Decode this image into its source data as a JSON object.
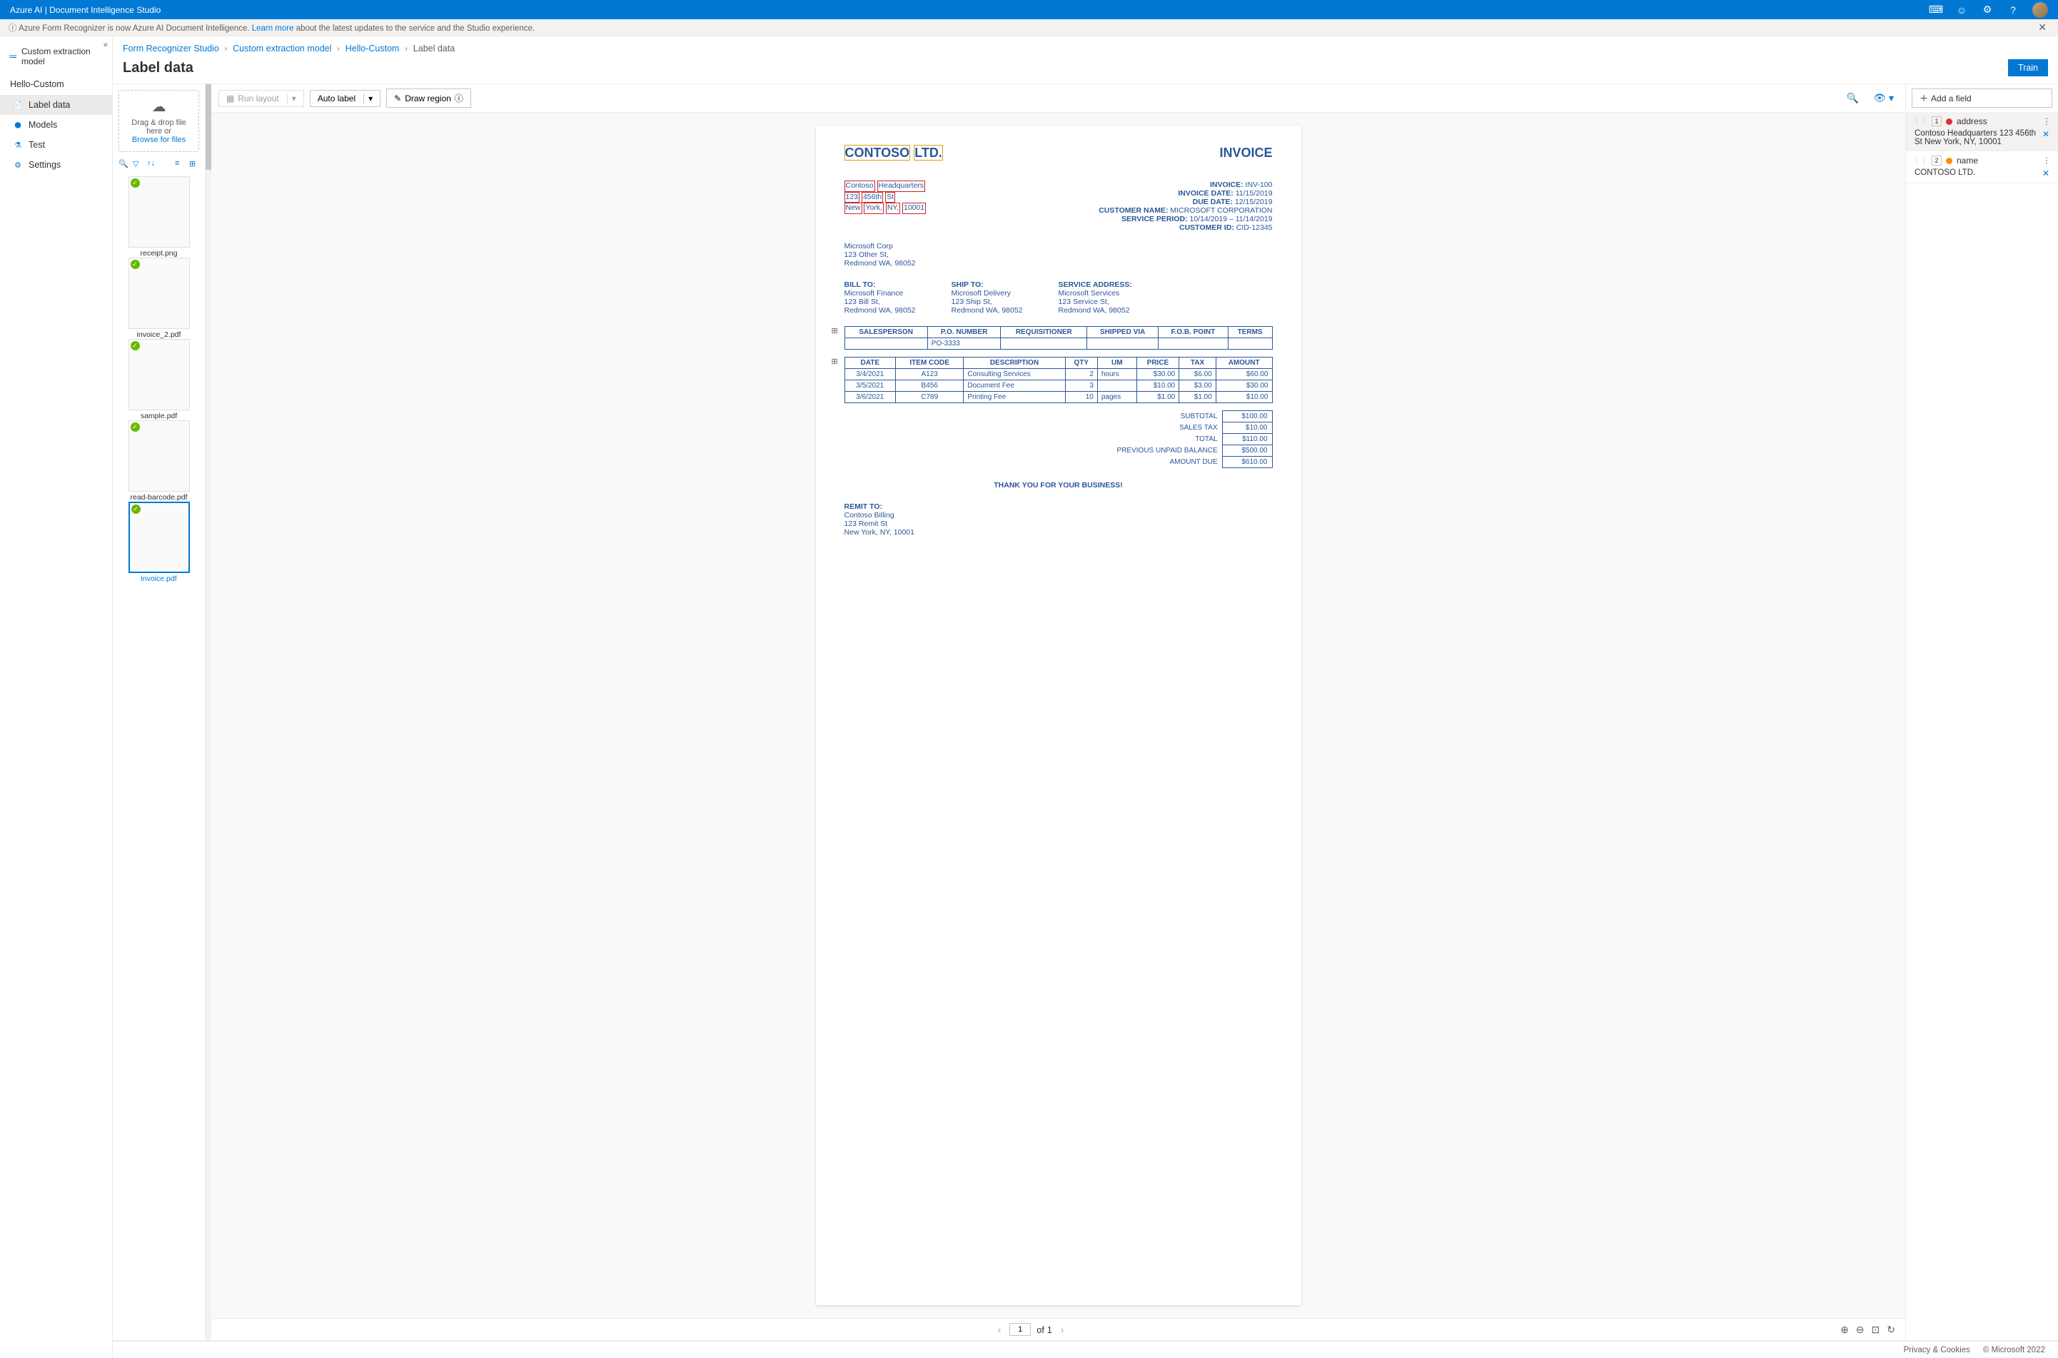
{
  "header": {
    "title": "Azure AI | Document Intelligence Studio"
  },
  "info_bar": {
    "icon": "ⓘ",
    "text_before": "Azure Form Recognizer is now Azure AI Document Intelligence. ",
    "link": "Learn more",
    "text_after": " about the latest updates to the service and the Studio experience."
  },
  "sidebar": {
    "heading": "Custom extraction model",
    "project": "Hello-Custom",
    "items": [
      {
        "icon": "📄",
        "label": "Label data",
        "active": true
      },
      {
        "icon": "⬢",
        "label": "Models",
        "active": false
      },
      {
        "icon": "⚗",
        "label": "Test",
        "active": false
      },
      {
        "icon": "⚙",
        "label": "Settings",
        "active": false
      }
    ]
  },
  "breadcrumb": [
    {
      "label": "Form Recognizer Studio",
      "link": true
    },
    {
      "label": "Custom extraction model",
      "link": true
    },
    {
      "label": "Hello-Custom",
      "link": true
    },
    {
      "label": "Label data",
      "link": false
    }
  ],
  "page_title": "Label data",
  "train_button": "Train",
  "drop_zone": {
    "line1": "Drag & drop file here or",
    "link": "Browse for files"
  },
  "files": [
    {
      "name": "receipt.png",
      "selected": false,
      "analyzed": true
    },
    {
      "name": "invoice_2.pdf",
      "selected": false,
      "analyzed": true
    },
    {
      "name": "sample.pdf",
      "selected": false,
      "analyzed": true
    },
    {
      "name": "read-barcode.pdf",
      "selected": false,
      "analyzed": true
    },
    {
      "name": "invoice.pdf",
      "selected": true,
      "analyzed": true
    }
  ],
  "doc_toolbar": {
    "run_layout": "Run layout",
    "auto_label": "Auto label",
    "draw_region": "Draw region"
  },
  "invoice": {
    "company": "CONTOSO LTD.",
    "company_word_1": "CONTOSO",
    "company_word_2": "LTD.",
    "invoice_word": "INVOICE",
    "address_lines": [
      [
        "Contoso",
        "Headquarters"
      ],
      [
        "123",
        "456th",
        "St"
      ],
      [
        "New",
        "York,",
        "NY,",
        "10001"
      ]
    ],
    "meta": [
      {
        "label": "INVOICE:",
        "value": "INV-100"
      },
      {
        "label": "INVOICE DATE:",
        "value": "11/15/2019"
      },
      {
        "label": "DUE DATE:",
        "value": "12/15/2019"
      },
      {
        "label": "CUSTOMER NAME:",
        "value": "MICROSOFT CORPORATION"
      },
      {
        "label": "SERVICE PERIOD:",
        "value": "10/14/2019 – 11/14/2019"
      },
      {
        "label": "CUSTOMER ID:",
        "value": "CID-12345"
      }
    ],
    "customer": [
      "Microsoft Corp",
      "123 Other St,",
      "Redmond WA, 98052"
    ],
    "bill_to": {
      "title": "BILL TO:",
      "lines": [
        "Microsoft Finance",
        "123 Bill St,",
        "Redmond WA, 98052"
      ]
    },
    "ship_to": {
      "title": "SHIP TO:",
      "lines": [
        "Microsoft Delivery",
        "123 Ship St,",
        "Redmond WA, 98052"
      ]
    },
    "service_addr": {
      "title": "SERVICE ADDRESS:",
      "lines": [
        "Microsoft Services",
        "123 Service St,",
        "Redmond WA, 98052"
      ]
    },
    "table1": {
      "headers": [
        "SALESPERSON",
        "P.O. NUMBER",
        "REQUISITIONER",
        "SHIPPED VIA",
        "F.O.B. POINT",
        "TERMS"
      ],
      "rows": [
        [
          "",
          "PO-3333",
          "",
          "",
          "",
          ""
        ]
      ]
    },
    "table2": {
      "headers": [
        "DATE",
        "ITEM CODE",
        "DESCRIPTION",
        "QTY",
        "UM",
        "PRICE",
        "TAX",
        "AMOUNT"
      ],
      "rows": [
        [
          "3/4/2021",
          "A123",
          "Consulting Services",
          "2",
          "hours",
          "$30.00",
          "$6.00",
          "$60.00"
        ],
        [
          "3/5/2021",
          "B456",
          "Document Fee",
          "3",
          "",
          "$10.00",
          "$3.00",
          "$30.00"
        ],
        [
          "3/6/2021",
          "C789",
          "Printing Fee",
          "10",
          "pages",
          "$1.00",
          "$1.00",
          "$10.00"
        ]
      ]
    },
    "totals": [
      {
        "label": "SUBTOTAL",
        "value": "$100.00"
      },
      {
        "label": "SALES TAX",
        "value": "$10.00"
      },
      {
        "label": "TOTAL",
        "value": "$110.00"
      },
      {
        "label": "PREVIOUS UNPAID BALANCE",
        "value": "$500.00"
      },
      {
        "label": "AMOUNT DUE",
        "value": "$610.00"
      }
    ],
    "thanks": "THANK YOU FOR YOUR BUSINESS!",
    "remit": {
      "title": "REMIT TO:",
      "lines": [
        "Contoso Billing",
        "123 Remit St",
        "New York, NY, 10001"
      ]
    }
  },
  "pager": {
    "current": "1",
    "total": "of 1"
  },
  "fields_panel": {
    "add_field": "Add a field",
    "fields": [
      {
        "num": "1",
        "color": "red",
        "name": "address",
        "value": "Contoso Headquarters 123 456th St New York, NY, 10001",
        "active": true
      },
      {
        "num": "2",
        "color": "orange",
        "name": "name",
        "value": "CONTOSO LTD.",
        "active": false
      }
    ]
  },
  "footer": {
    "privacy": "Privacy & Cookies",
    "copyright": "© Microsoft 2022"
  }
}
